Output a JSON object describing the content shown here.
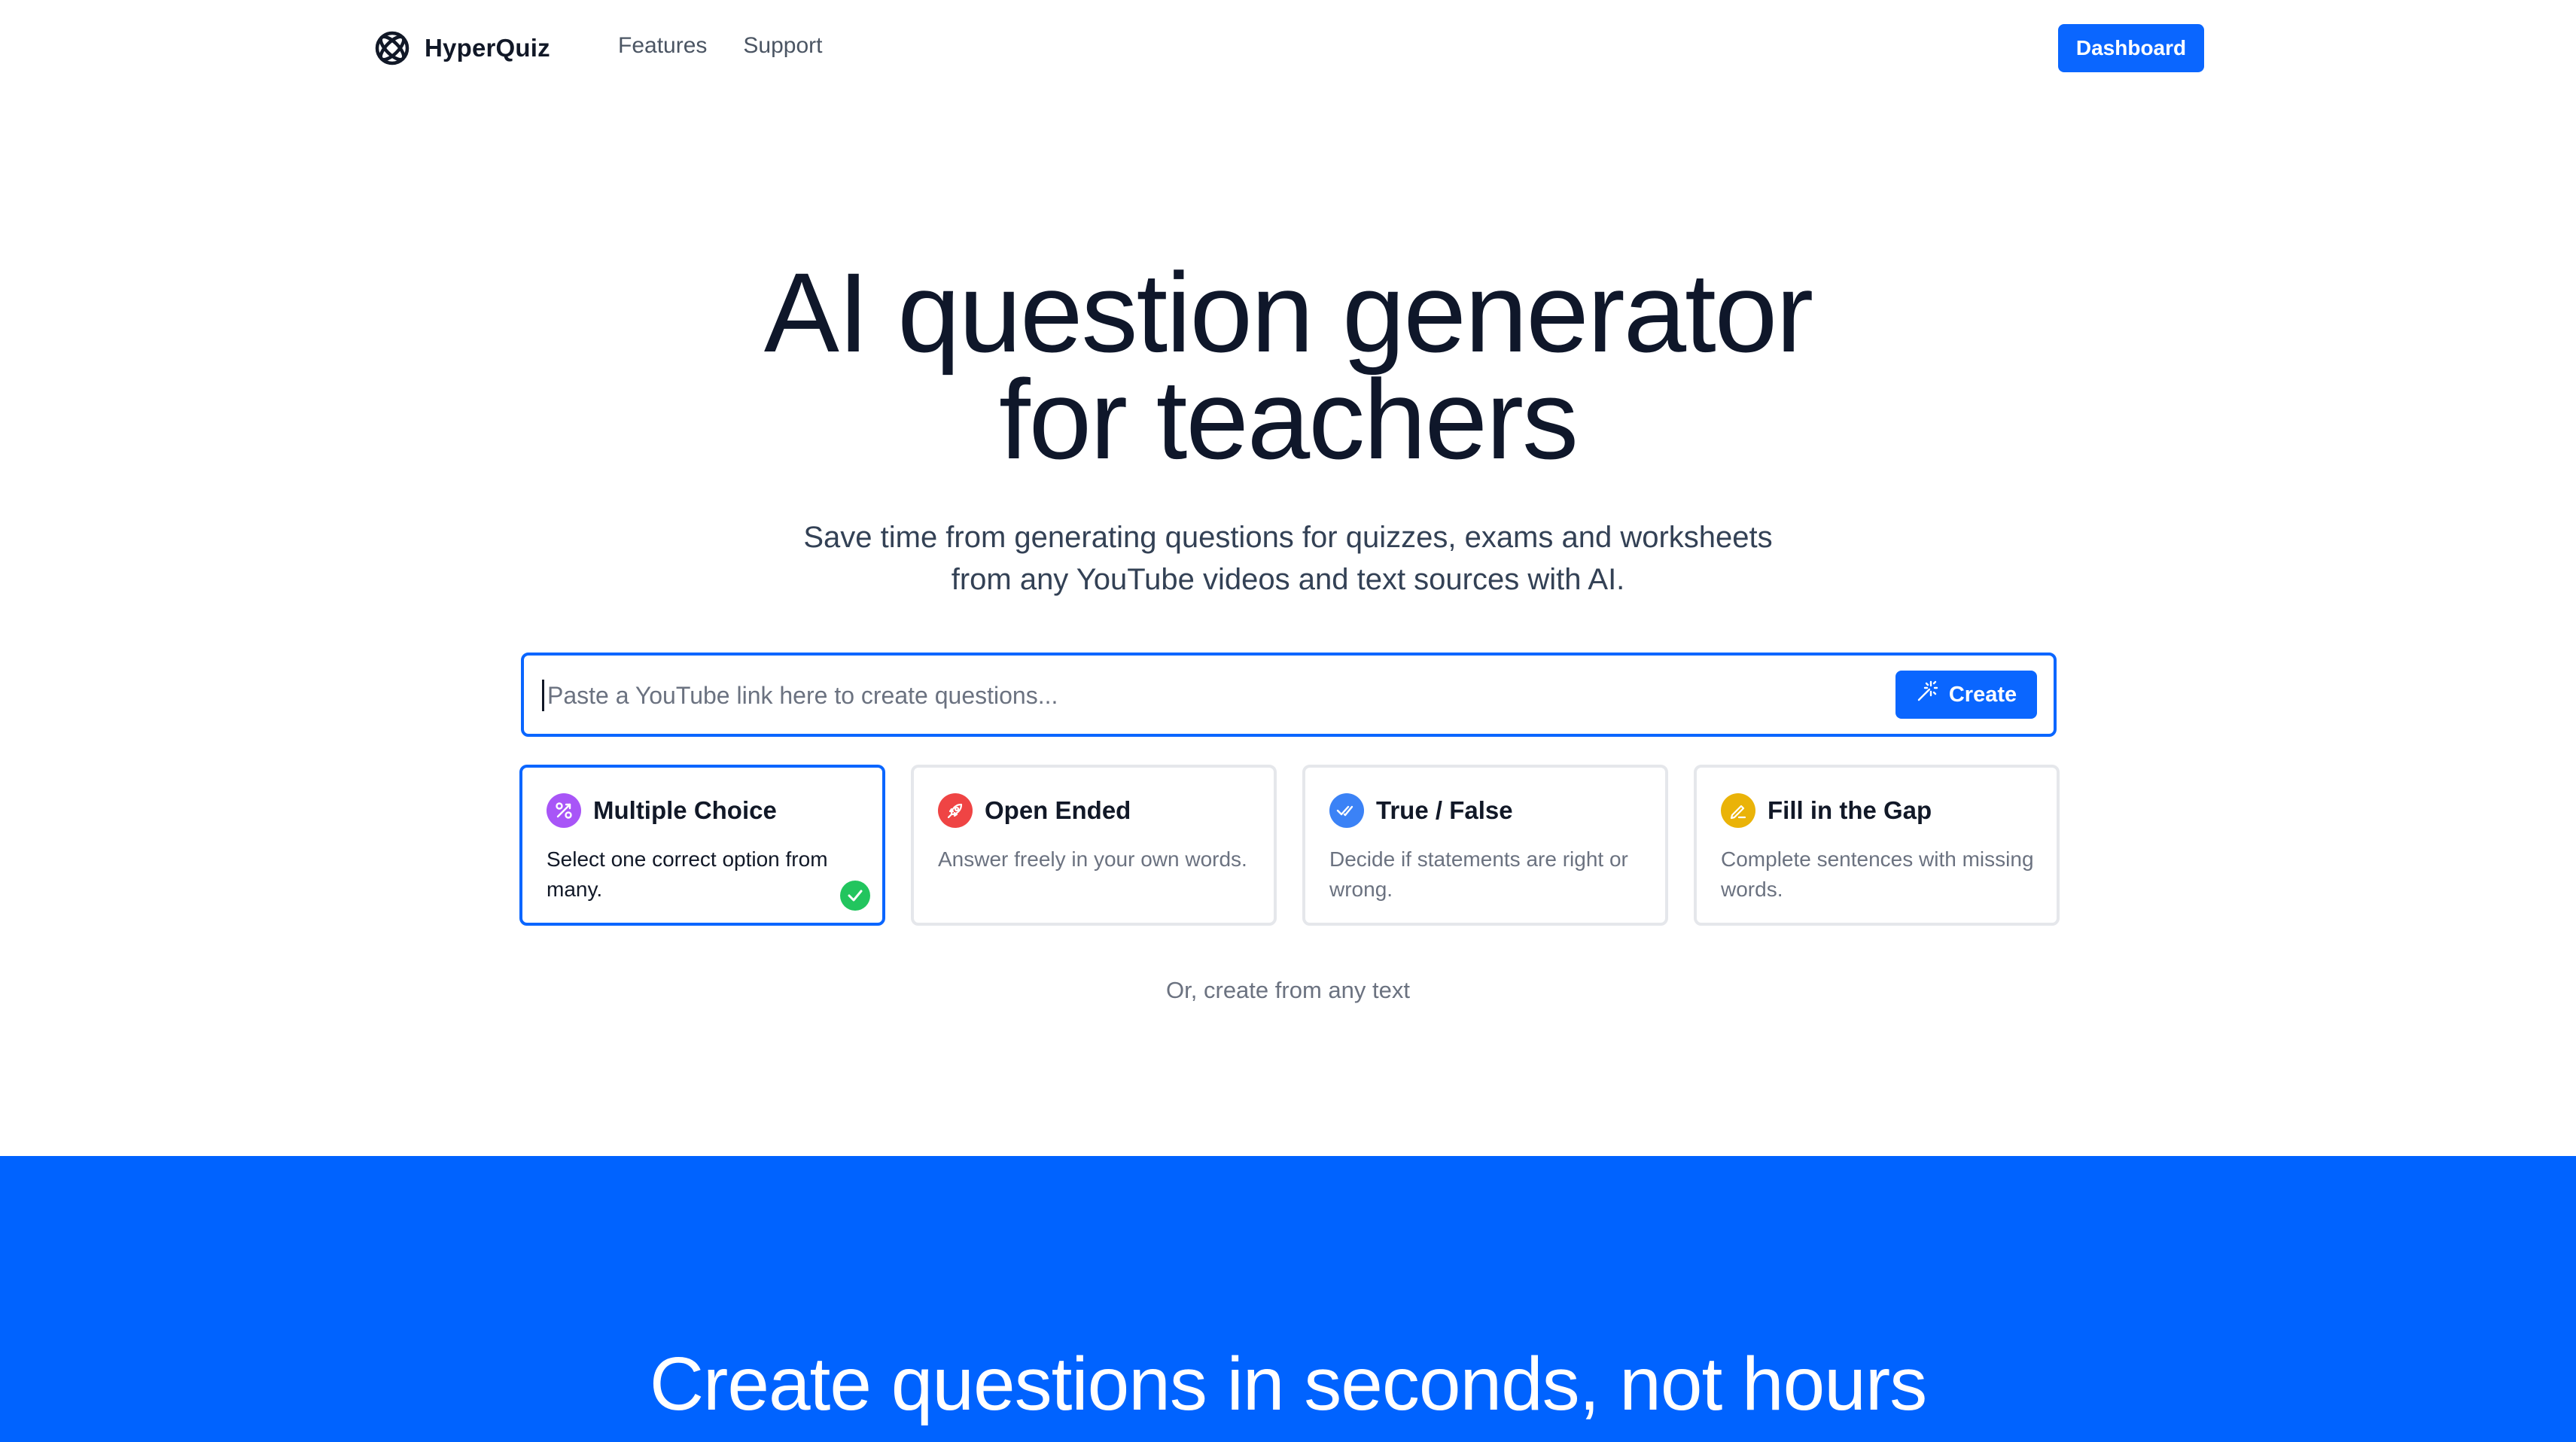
{
  "header": {
    "brand": "HyperQuiz",
    "nav": [
      "Features",
      "Support"
    ],
    "dashboard_label": "Dashboard"
  },
  "hero": {
    "title_line1": "AI question generator",
    "title_line2": "for teachers",
    "subtitle_line1": "Save time from generating questions for quizzes, exams and worksheets",
    "subtitle_line2": "from any YouTube videos and text sources with AI."
  },
  "search": {
    "placeholder": "Paste a YouTube link here to create questions...",
    "value": "",
    "button_label": "Create"
  },
  "question_types": [
    {
      "title": "Multiple Choice",
      "description": "Select one correct option from many.",
      "icon": "multiple-choice-icon",
      "color": "#a855f7",
      "selected": true
    },
    {
      "title": "Open Ended",
      "description": "Answer freely in your own words.",
      "icon": "rocket-icon",
      "color": "#ef4444",
      "selected": false
    },
    {
      "title": "True / False",
      "description": "Decide if statements are right or wrong.",
      "icon": "double-check-icon",
      "color": "#3b82f6",
      "selected": false
    },
    {
      "title": "Fill in the Gap",
      "description": "Complete sentences with missing words.",
      "icon": "pencil-icon",
      "color": "#eab308",
      "selected": false
    }
  ],
  "alt_link": "Or, create from any text",
  "band": {
    "title": "Create questions in seconds, not hours",
    "background": "#0063ff"
  },
  "colors": {
    "accent": "#0a66ff",
    "selected_check": "#22c55e"
  }
}
